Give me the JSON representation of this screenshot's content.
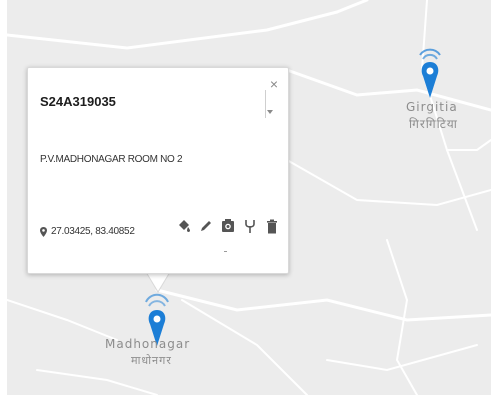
{
  "map": {
    "background_color": "#ececec",
    "road_color": "#ffffff",
    "label_color": "#8d8d8d",
    "pin_color": "#1c7ed6",
    "places": [
      {
        "name_latin": "Girgitia",
        "name_local": "गिरगिटिया"
      },
      {
        "name_latin": "Madhonagar",
        "name_local": "माधोनगर"
      }
    ]
  },
  "popup": {
    "title": "S24A319035",
    "close_glyph": "×",
    "description": "P.V.MADHONAGAR ROOM NO 2",
    "coordinates": "27.03425, 83.40852",
    "actions": [
      {
        "icon": "fill-bucket-icon"
      },
      {
        "icon": "pencil-icon"
      },
      {
        "icon": "camera-icon"
      },
      {
        "icon": "fork-icon"
      },
      {
        "icon": "trash-icon"
      }
    ]
  }
}
